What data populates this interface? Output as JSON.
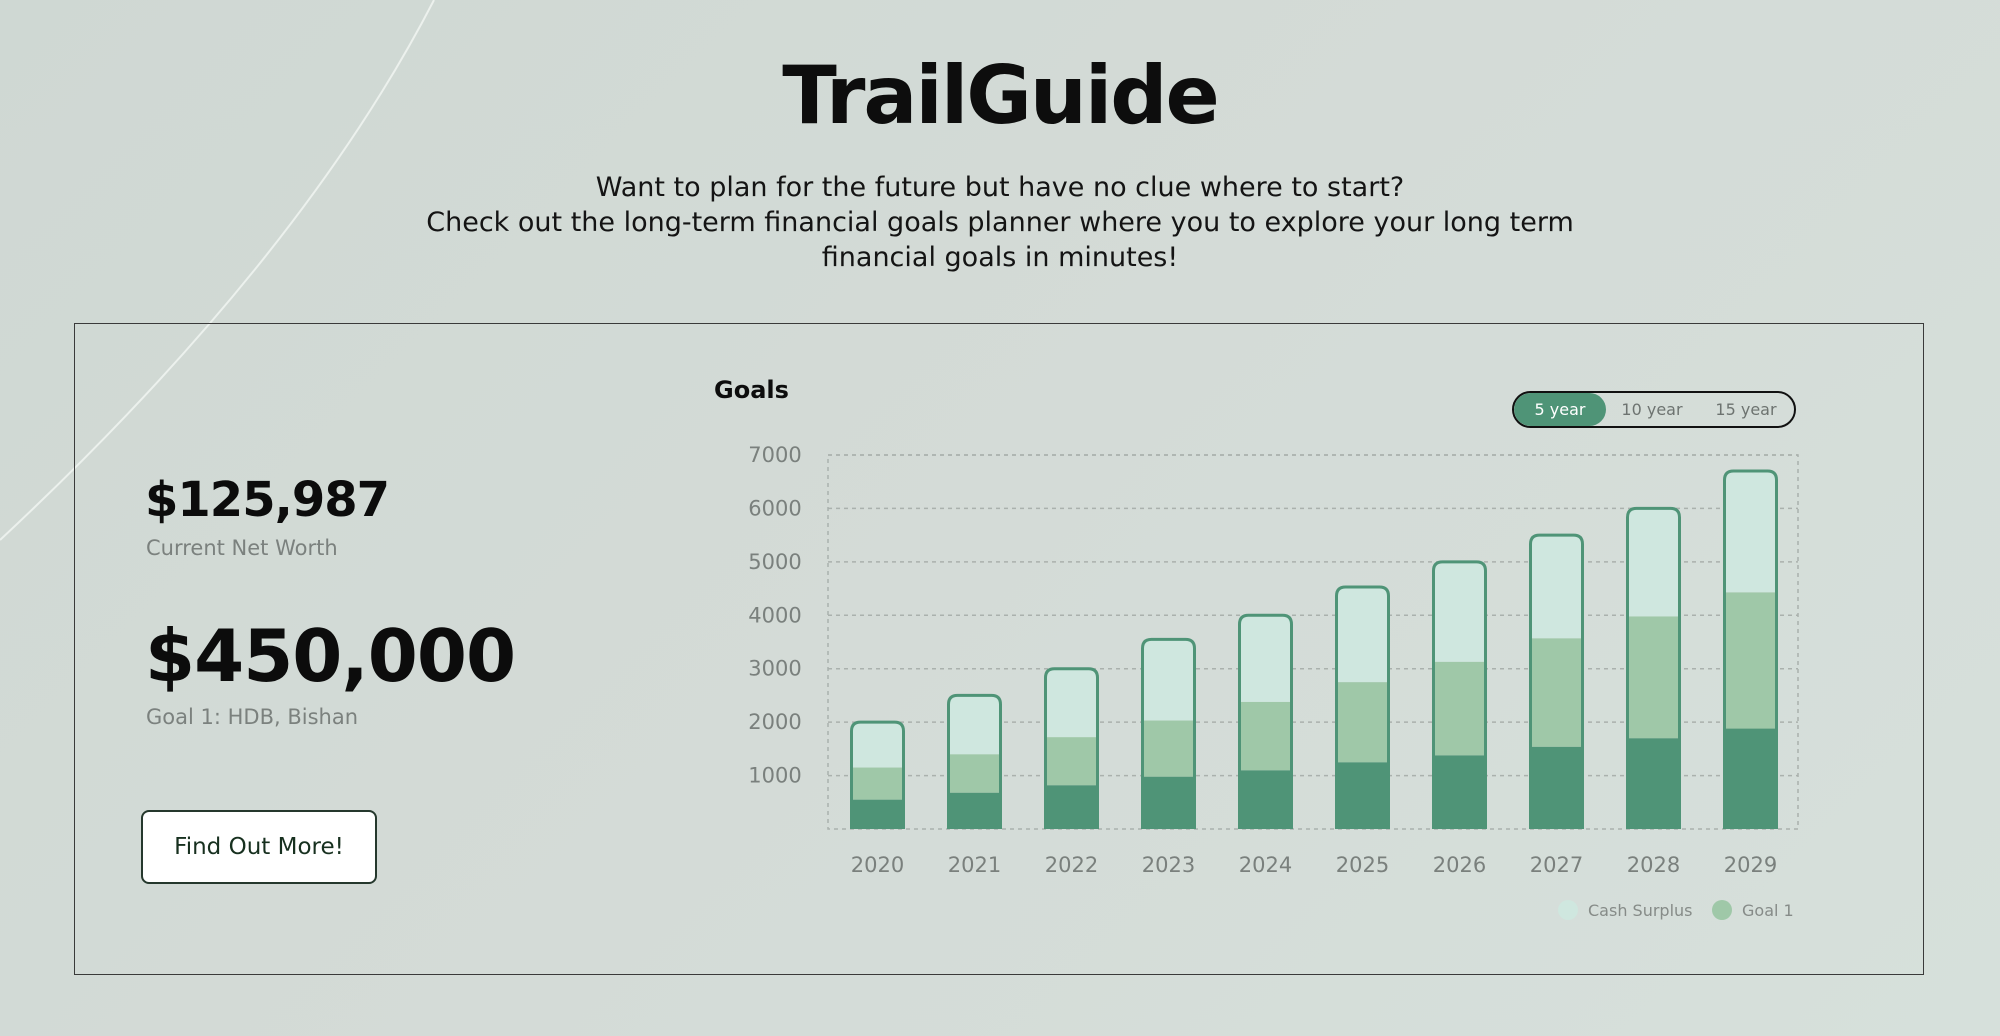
{
  "brand": {
    "title": "TrailGuide"
  },
  "tagline": {
    "line1": "Want to plan for the future but have no clue where to start?",
    "line2": "Check out the long-term financial goals planner where you to explore your long term",
    "line3": "financial goals in minutes!"
  },
  "summary": {
    "net_worth_value": "$125,987",
    "net_worth_label": "Current Net Worth",
    "goal_value": "$450,000",
    "goal_label": "Goal 1: HDB, Bishan",
    "cta_label": "Find Out More!"
  },
  "chart_panel": {
    "title": "Goals",
    "range_options": [
      "5 year",
      "10 year",
      "15 year"
    ],
    "selected_range": "5 year"
  },
  "colors": {
    "accent": "#4f9477",
    "goal": "#9fc8a8",
    "cash_surplus": "#cfe7df",
    "bar_outline": "#4f9477"
  },
  "chart_data": {
    "type": "bar",
    "stacked": true,
    "categories": [
      "2020",
      "2021",
      "2022",
      "2023",
      "2024",
      "2025",
      "2026",
      "2027",
      "2028",
      "2029"
    ],
    "series": [
      {
        "name": "",
        "values": [
          550,
          680,
          820,
          980,
          1100,
          1250,
          1380,
          1540,
          1700,
          1880
        ]
      },
      {
        "name": "Goal 1",
        "values": [
          600,
          720,
          900,
          1050,
          1280,
          1500,
          1750,
          2030,
          2280,
          2550
        ]
      },
      {
        "name": "Cash Surplus",
        "values": [
          850,
          1100,
          1280,
          1520,
          1620,
          1780,
          1870,
          1930,
          2020,
          2270
        ]
      }
    ],
    "yticks": [
      1000,
      2000,
      3000,
      4000,
      5000,
      6000,
      7000
    ],
    "ylim": [
      0,
      7000
    ],
    "grid": true,
    "legend": [
      "Cash Surplus",
      "Goal 1"
    ],
    "legend_position": "bottom-right",
    "title": "Goals",
    "xlabel": "",
    "ylabel": ""
  }
}
